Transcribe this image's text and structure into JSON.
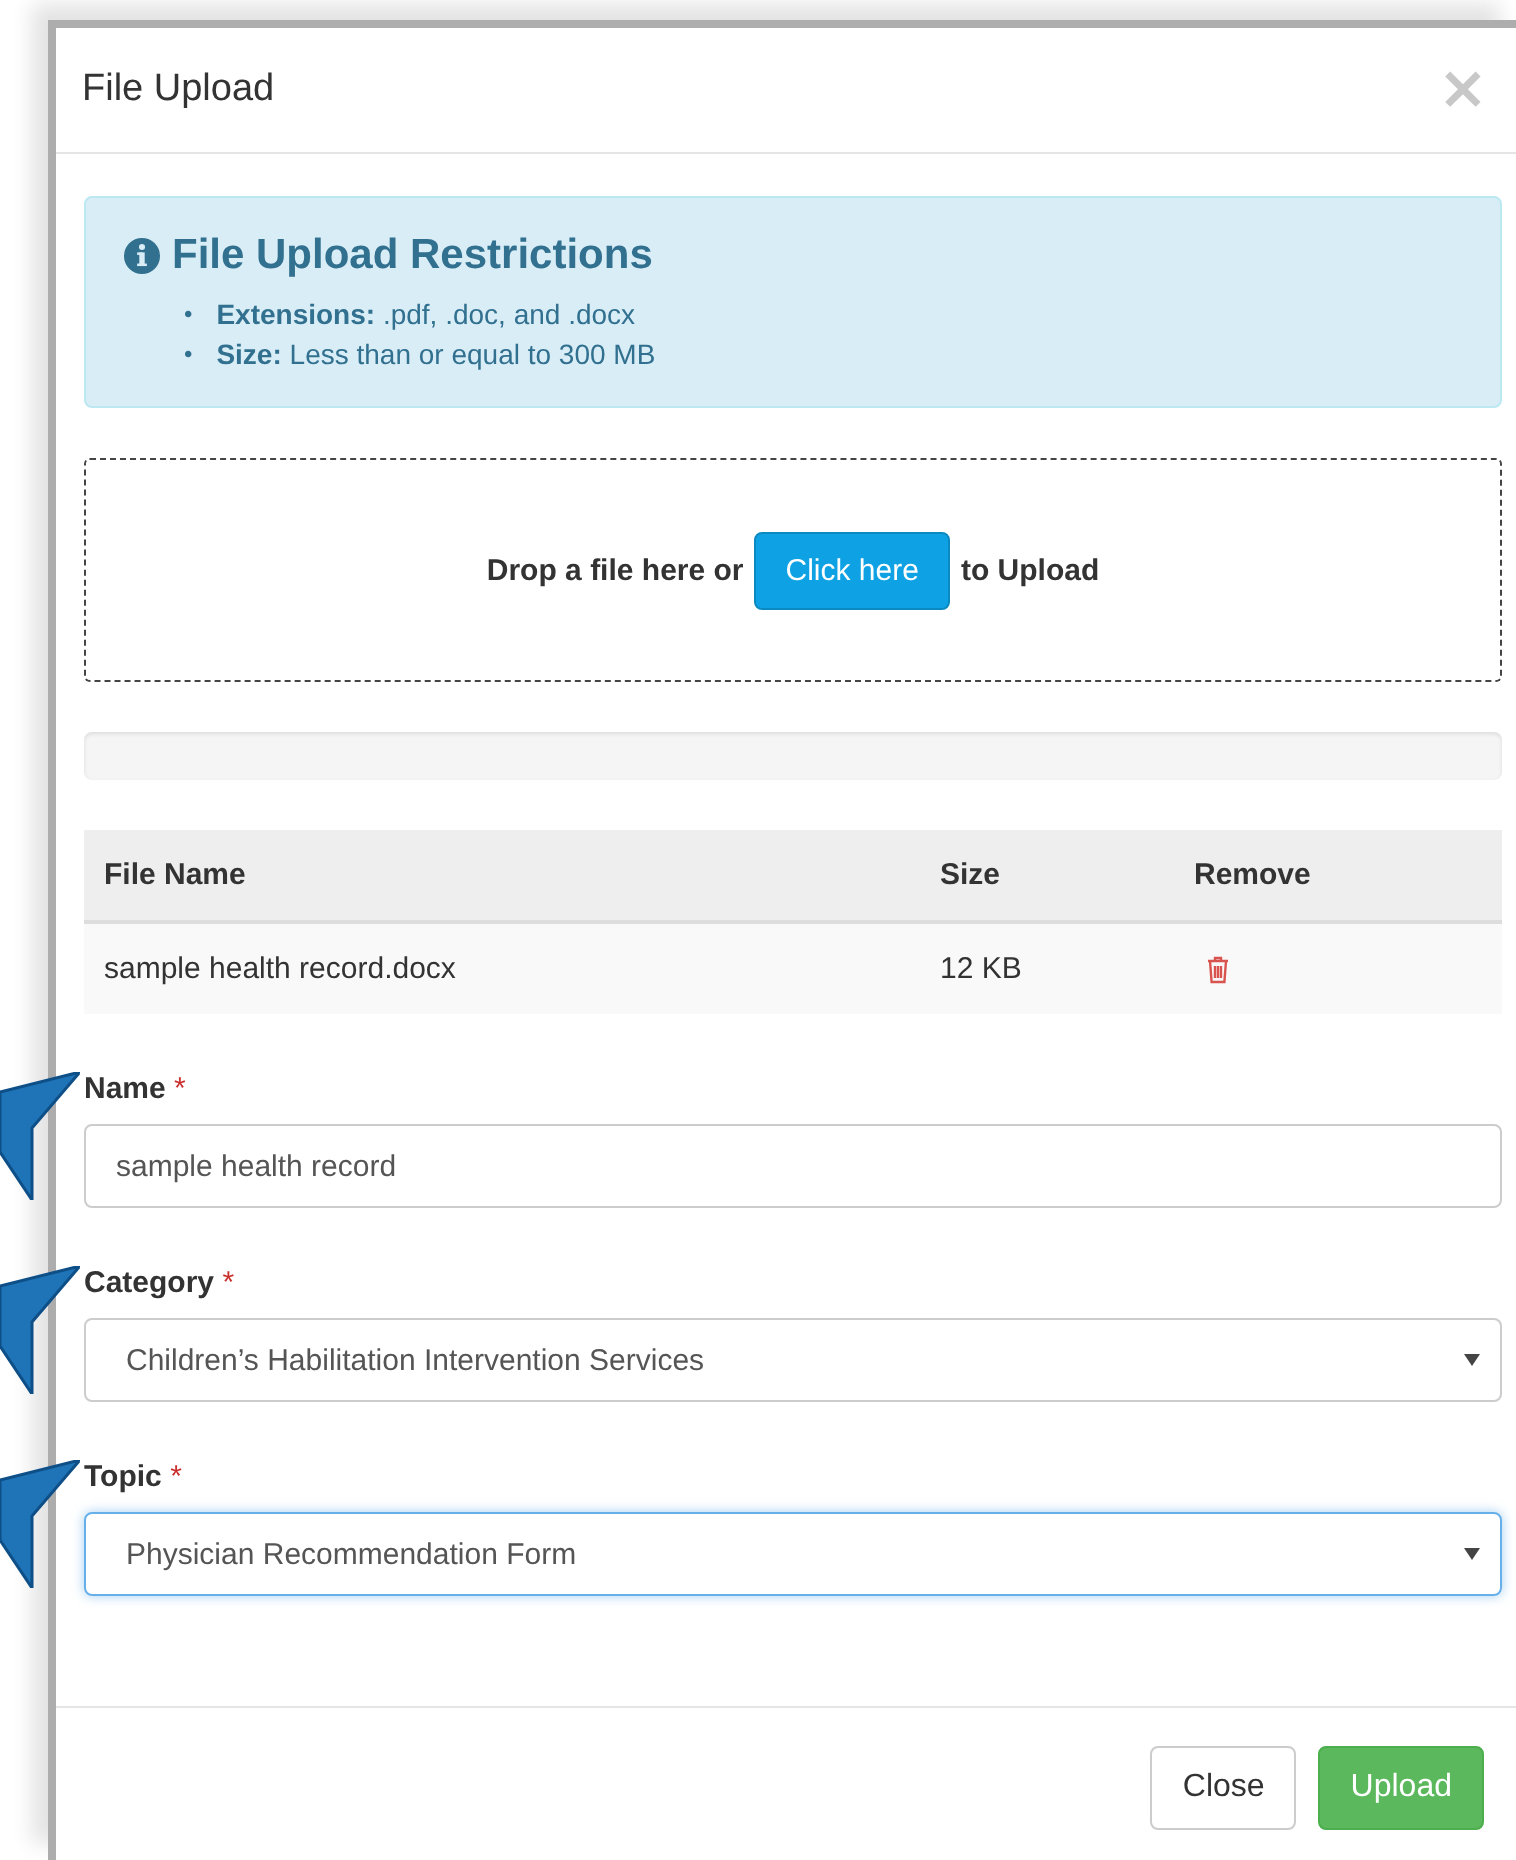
{
  "dialog": {
    "title": "File Upload",
    "close": "×"
  },
  "restrictions": {
    "title": "File Upload Restrictions",
    "items": [
      {
        "bullet": "•",
        "label": "Extensions:",
        "text": ".pdf, .doc, and .docx"
      },
      {
        "bullet": "•",
        "label": "Size:",
        "text": "Less than or equal to 300 MB"
      }
    ]
  },
  "dropzone": {
    "before": "Drop a file here or",
    "button": "Click here",
    "after": "to Upload"
  },
  "progress": {
    "level": 0
  },
  "table": {
    "columns": [
      "File Name",
      "Size",
      "Remove"
    ],
    "rows": [
      {
        "file_name": "sample health record.docx",
        "size": "12 KB"
      }
    ]
  },
  "fields": [
    {
      "kind": "text",
      "label": "Name",
      "required": "*",
      "value": "sample health record",
      "focused": false,
      "starred": true
    },
    {
      "kind": "select",
      "label": "Category",
      "required": "*",
      "value": "Children’s Habilitation Intervention Services",
      "focused": false,
      "starred": true
    },
    {
      "kind": "select",
      "label": "Topic",
      "required": "*",
      "value": "Physician Recommendation Form",
      "focused": true,
      "starred": true
    }
  ],
  "buttons": [
    {
      "label": "Close",
      "kind": "default"
    },
    {
      "label": "Upload",
      "kind": "success"
    }
  ]
}
